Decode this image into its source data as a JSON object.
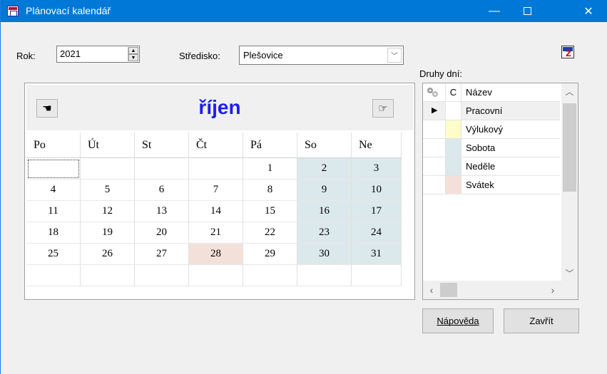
{
  "window": {
    "title": "Plánovací kalendář",
    "minimize_glyph": "—",
    "close_glyph": "✕"
  },
  "form": {
    "year_label": "Rok:",
    "year_value": "2021",
    "center_label": "Středisko:",
    "center_value": "Plešovice"
  },
  "calendar": {
    "month": "říjen",
    "prev_glyph": "☚",
    "next_glyph": "☞",
    "weekdays": [
      "Po",
      "Út",
      "St",
      "Čt",
      "Pá",
      "So",
      "Ne"
    ],
    "weeks": [
      [
        "",
        "",
        "",
        "",
        "1",
        "2",
        "3"
      ],
      [
        "4",
        "5",
        "6",
        "7",
        "8",
        "9",
        "10"
      ],
      [
        "11",
        "12",
        "13",
        "14",
        "15",
        "16",
        "17"
      ],
      [
        "18",
        "19",
        "20",
        "21",
        "22",
        "23",
        "24"
      ],
      [
        "25",
        "26",
        "27",
        "28",
        "29",
        "30",
        "31"
      ],
      [
        "",
        "",
        "",
        "",
        "",
        "",
        ""
      ]
    ],
    "holiday_day": "28",
    "colors": {
      "weekend": "#dce9ec",
      "holiday": "#f3e1d9",
      "month_title": "#1c1ef0"
    }
  },
  "day_types": {
    "label": "Druhy dní:",
    "headers": {
      "color": "C",
      "name": "Název"
    },
    "rows": [
      {
        "name": "Pracovní",
        "color": "#ffffff",
        "current": true
      },
      {
        "name": "Výlukový",
        "color": "#fefcc8",
        "current": false
      },
      {
        "name": "Sobota",
        "color": "#dce9ec",
        "current": false
      },
      {
        "name": "Neděle",
        "color": "#dce9ec",
        "current": false
      },
      {
        "name": "Svátek",
        "color": "#f3e1d9",
        "current": false
      }
    ]
  },
  "buttons": {
    "help_label": "Nápověda",
    "close_label": "Zavřít"
  },
  "icons": [
    "app-calendar-icon",
    "export-icon",
    "settings-gears-icon",
    "prev-month-hand-icon",
    "next-month-hand-icon",
    "row-pointer-icon"
  ]
}
